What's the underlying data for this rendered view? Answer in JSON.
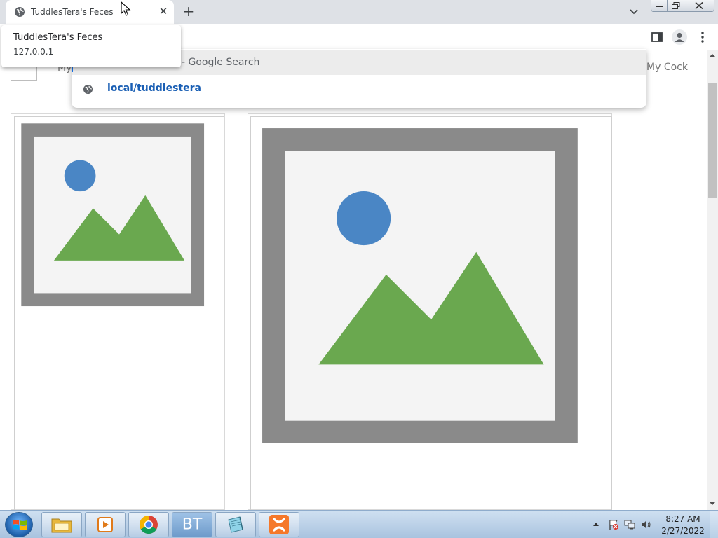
{
  "browser": {
    "tab": {
      "title": "TuddlesTera's Feces",
      "close_label": "✕"
    },
    "new_tab_label": "+",
    "hover_card": {
      "title": "TuddlesTera's Feces",
      "url": "127.0.0.1"
    }
  },
  "omnibox": {
    "suggestions": [
      {
        "text": "- Google Search",
        "icon": "search-icon"
      },
      {
        "text": "local/tuddlestera",
        "icon": "globe-icon"
      }
    ]
  },
  "page": {
    "nav_left": "My",
    "nav_right": "My Cock"
  },
  "taskbar": {
    "buttons": [
      {
        "name": "file-explorer",
        "icon": "folder-icon"
      },
      {
        "name": "media-player",
        "icon": "media-player-icon"
      },
      {
        "name": "chrome",
        "icon": "chrome-icon"
      },
      {
        "name": "bt-app",
        "label": "BT"
      },
      {
        "name": "notepad",
        "icon": "notepad-icon"
      },
      {
        "name": "xampp",
        "icon": "xampp-icon"
      }
    ],
    "clock": {
      "time": "8:27 AM",
      "date": "2/27/2022"
    }
  },
  "colors": {
    "accent_blue": "#1a73e8",
    "suggestion_link": "#1a5fb4",
    "xampp_orange": "#f5782a"
  }
}
